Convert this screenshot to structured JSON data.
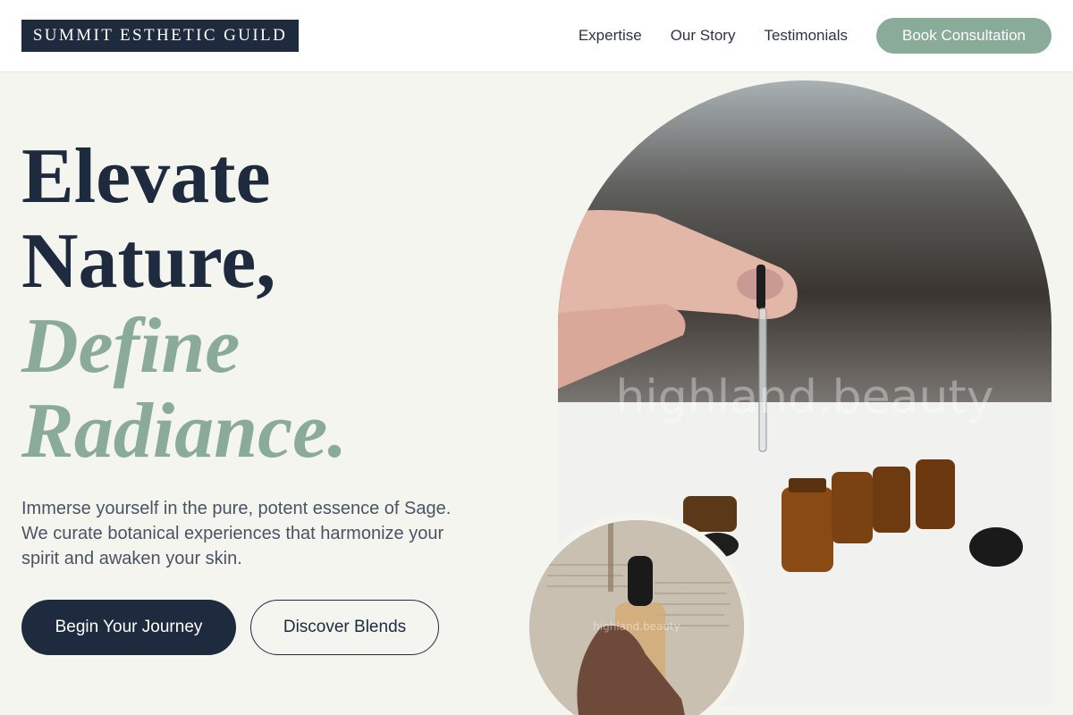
{
  "brand": {
    "name": "SUMMIT ESTHETIC GUILD"
  },
  "nav": {
    "links": [
      "Expertise",
      "Our Story",
      "Testimonials"
    ],
    "cta": "Book Consultation"
  },
  "hero": {
    "headline_line1": "Elevate",
    "headline_line2": "Nature,",
    "headline_accent1": "Define",
    "headline_accent2": "Radiance.",
    "description": "Immerse yourself in the pure, potent essence of Sage. We curate botanical experiences that harmonize your spirit and awaken your skin.",
    "primary_button": "Begin Your Journey",
    "secondary_button": "Discover Blends"
  },
  "images": {
    "main_watermark": "highland.beauty",
    "small_watermark": "highland.beauty"
  },
  "colors": {
    "navy": "#1e2a3e",
    "sage": "#8aaa9a",
    "background": "#f5f5f0"
  }
}
